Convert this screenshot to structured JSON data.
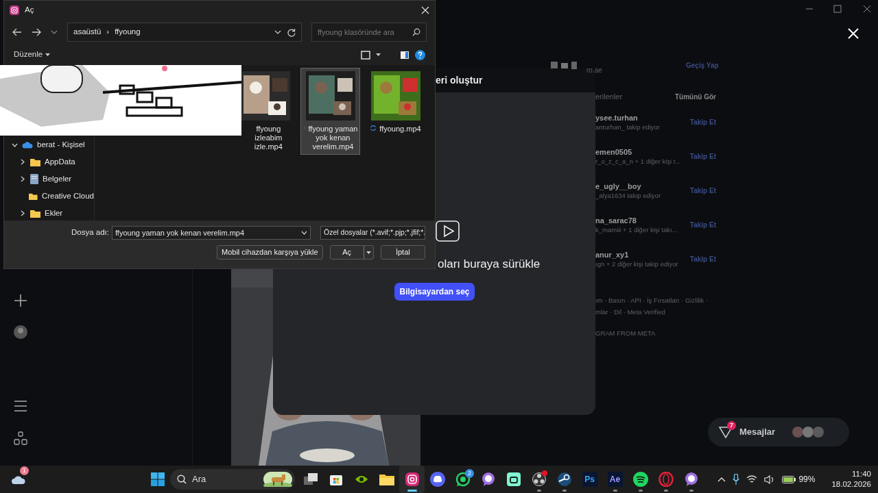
{
  "instagram": {
    "account": {
      "handle": "ro.ae",
      "switch": "Geçiş Yap"
    },
    "modal": {
      "title": "eri oluştur",
      "prompt": "oları buraya sürükle",
      "button": "Bilgisayardan seç"
    },
    "suggestions": {
      "title": "erilenler",
      "see_all": "Tümünü Gör",
      "items": [
        {
          "name": "ysee.turhan",
          "sub": "anturhan_ takip ediyor",
          "action": "Takip Et"
        },
        {
          "name": "emen0505",
          "sub": "r_o_z_c_a_n + 1 diğer kişi t...",
          "action": "Takip Et"
        },
        {
          "name": "e_ugly__boy",
          "sub": "_alya1634 takip ediyor",
          "action": "Takip Et"
        },
        {
          "name": "na_sarac78",
          "sub": "k_mamiii + 1 diğer kişi takı...",
          "action": "Takip Et"
        },
        {
          "name": "anur_xy1",
          "sub": "ıgn + 2 diğer kişi takip ediyor",
          "action": "Takip Et"
        }
      ]
    },
    "footer": [
      "ım · Basın · API · İş Fırsatları · Gizlilik ·",
      "mlar · Dil · Meta Verified",
      "GRAM FROM META"
    ],
    "messages": {
      "label": "Mesajlar",
      "badge": "7"
    }
  },
  "dialog": {
    "title": "Aç",
    "breadcrumb": [
      "asaüstü",
      "ffyoung"
    ],
    "separator": "›",
    "search": {
      "placeholder": "ffyoung klasöründe ara"
    },
    "organize": "Düzenle",
    "tree": [
      {
        "label": "berat - Kişisel",
        "kind": "cloud",
        "expandable": true,
        "expanded": true,
        "children": [
          {
            "label": "AppData",
            "kind": "folder",
            "expandable": true,
            "expanded": false
          },
          {
            "label": "Belgeler",
            "kind": "document",
            "expandable": true,
            "expanded": false
          },
          {
            "label": "Creative Cloud",
            "kind": "folder",
            "expandable": false
          },
          {
            "label": "Ekler",
            "kind": "folder",
            "expandable": true,
            "expanded": false
          }
        ]
      }
    ],
    "files": [
      {
        "name": "ffyoung izleabim izle.mp4",
        "selected": false
      },
      {
        "name": "ffyoung yaman yok kenan verelim.mp4",
        "selected": true
      },
      {
        "name": "ffyoung.mp4",
        "selected": false
      }
    ],
    "filename_label": "Dosya adı:",
    "filename": "ffyoung yaman yok kenan verelim.mp4",
    "filter": "Özel dosyalar (*.avif;*.pjp;*.jfif;*.",
    "buttons": [
      {
        "label": "Mobil cihazdan karşıya yükle",
        "kind": "plain"
      },
      {
        "label": "Aç",
        "kind": "split"
      },
      {
        "label": "İptal",
        "kind": "plain"
      }
    ]
  },
  "taskbar": {
    "weather_badge": "1",
    "search": "Ara",
    "apps": [
      {
        "kind": "taskview",
        "running": false,
        "active": false
      },
      {
        "kind": "store",
        "running": false,
        "active": false
      },
      {
        "kind": "nvidia",
        "running": false,
        "active": false
      },
      {
        "kind": "explorer",
        "running": false,
        "active": false
      },
      {
        "kind": "instagram",
        "running": true,
        "active": true
      },
      {
        "kind": "discord",
        "running": false,
        "active": false
      },
      {
        "kind": "whatsapp",
        "running": false,
        "active": false,
        "badge": "2"
      },
      {
        "kind": "chat",
        "running": false,
        "active": false
      },
      {
        "kind": "stream",
        "running": false,
        "active": false
      },
      {
        "kind": "obs",
        "running": true,
        "active": false,
        "alert": true
      },
      {
        "kind": "steam",
        "running": true,
        "active": false
      },
      {
        "kind": "tile",
        "label": "Ps",
        "color": "#31a8ff",
        "running": false,
        "active": false
      },
      {
        "kind": "tile",
        "label": "Ae",
        "color": "#9999ff",
        "running": true,
        "active": false
      },
      {
        "kind": "spotify",
        "running": true,
        "active": false
      },
      {
        "kind": "opera",
        "running": true,
        "active": false
      },
      {
        "kind": "chat",
        "running": true,
        "active": false
      }
    ],
    "battery": "99%",
    "time": "11:40",
    "date": "18.02.2026"
  }
}
